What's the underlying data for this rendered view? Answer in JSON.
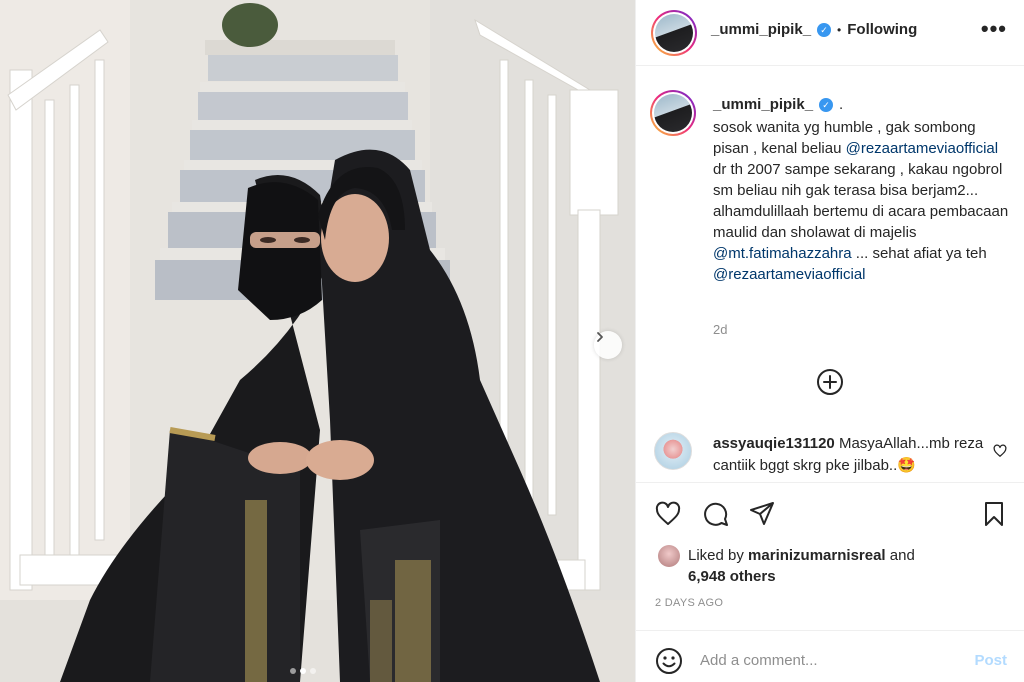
{
  "post": {
    "username": "_ummi_pipik_",
    "header_separator": "•",
    "follow_status": "Following",
    "more_label": "•••",
    "caption": {
      "user_suffix": ".",
      "t1": "sosok wanita yg humble , gak sombong pisan , kenal beliau ",
      "m1": "@rezaartameviaofficial",
      "t2": " dr th 2007 sampe sekarang , kakau ngobrol sm beliau nih gak terasa bisa berjam2... alhamdulillaah bertemu di acara pembacaan maulid dan sholawat di majelis ",
      "m2": "@mt.fatimahazzahra",
      "t3": " ... sehat afiat ya teh ",
      "m3": "@rezaartameviaofficial"
    },
    "time_ago": "2d",
    "comment": {
      "username": "assyauqie131120",
      "text": "MasyaAllah...mb reza cantiik bggt skrg pke jilbab..🤩"
    },
    "likes": {
      "prefix": "Liked by",
      "user": "marinizumarnisreal",
      "and": "and",
      "others": "6,948 others"
    },
    "date": "2 DAYS AGO",
    "add_comment": {
      "placeholder": "Add a comment...",
      "post_label": "Post"
    },
    "carousel": {
      "current": 2,
      "total": 3
    }
  },
  "icons": {
    "verified": "verified-badge-icon",
    "more": "more-options-icon",
    "add": "add-circle-icon",
    "like": "heart-icon",
    "comment": "comment-icon",
    "share": "share-icon",
    "save": "bookmark-icon",
    "emoji": "emoji-icon",
    "next": "chevron-right-icon"
  },
  "colors": {
    "link": "#00376b",
    "verified": "#3897f0",
    "muted": "#8e8e8e",
    "post_disabled": "#b3dbff"
  }
}
